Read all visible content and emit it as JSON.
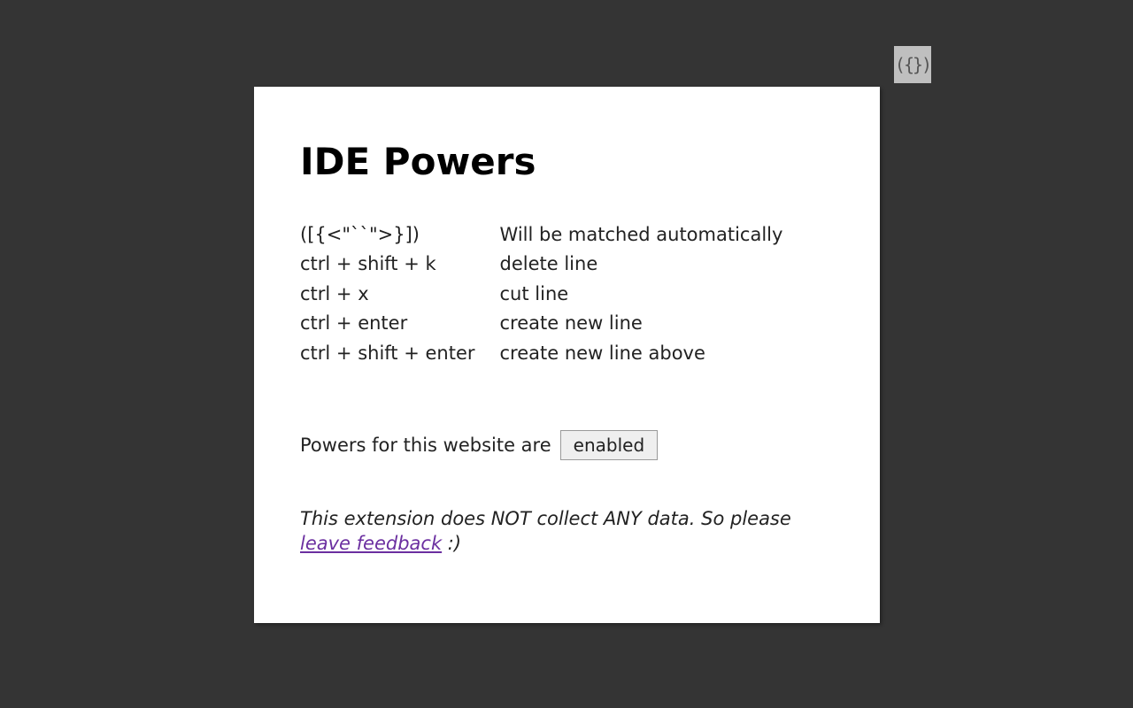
{
  "extension_icon_glyph": "({})",
  "popup": {
    "title": "IDE Powers",
    "shortcuts": [
      {
        "key": "([{<\"``\">}])",
        "desc": "Will be matched automatically"
      },
      {
        "key": "ctrl + shift + k",
        "desc": "delete line"
      },
      {
        "key": "ctrl + x",
        "desc": "cut line"
      },
      {
        "key": "ctrl + enter",
        "desc": "create new line"
      },
      {
        "key": "ctrl + shift + enter",
        "desc": "create new line above"
      }
    ],
    "status_prefix": "Powers for this website are",
    "toggle_label": "enabled",
    "footer_text_before": "This extension does NOT collect ANY data. So please ",
    "footer_link": "leave feedback",
    "footer_text_after": " :)"
  }
}
